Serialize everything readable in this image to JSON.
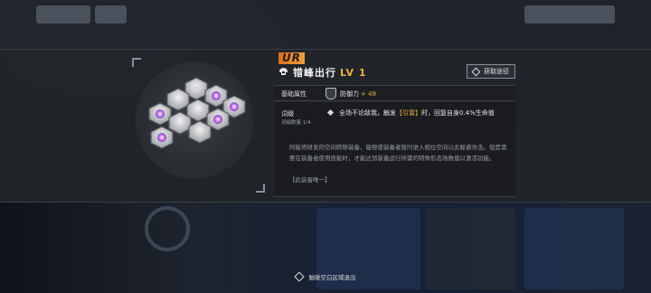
{
  "equipment": {
    "rarity": "UR",
    "name": "错峰出行",
    "level": "LV 1",
    "acquire_label": "获取途径"
  },
  "base_stats": {
    "label": "基础属性",
    "stat_name": "防御力",
    "stat_value": "+ 49"
  },
  "affix": {
    "label": "词缀",
    "count": "词缀数量 1/4",
    "text_before": "全场不论敌我，触发",
    "text_highlight": "【引雷】",
    "text_after": "时，回复自身0.4%生命值"
  },
  "lore": {
    "text": "阿能塔研发的空间转移装备，能够使装备者暂时进入相位空间以此躲避攻击。但是需要在装备者使用技能时，才能达到装备运行所需的特殊形态场数值以激活功能。",
    "tag": "【此装备唯一】"
  },
  "exit_hint": "触碰空白区域退出",
  "colors": {
    "accent_gold": "#e9b23a",
    "rarity_orange": "#e36b1c",
    "panel_bg": "#212429",
    "glow_purple": "#c46bff"
  },
  "icons": {
    "title": "helmet-icon",
    "acquire": "diamond-icon",
    "stat": "shield-icon",
    "exit": "diamond-outline-icon"
  }
}
